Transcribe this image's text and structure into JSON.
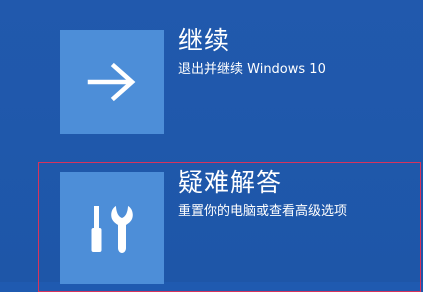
{
  "options": [
    {
      "title": "继续",
      "subtitle": "退出并继续 Windows 10",
      "icon": "arrow-right-icon"
    },
    {
      "title": "疑难解答",
      "subtitle": "重置你的电脑或查看高级选项",
      "icon": "tools-icon"
    }
  ],
  "colors": {
    "background": "#1f5ab0",
    "tile": "#4d8ed8",
    "text": "#ffffff",
    "highlight_border": "#d6335d"
  }
}
